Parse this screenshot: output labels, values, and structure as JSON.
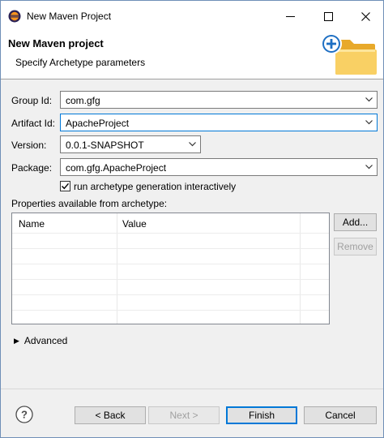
{
  "window": {
    "title": "New Maven Project"
  },
  "header": {
    "title": "New Maven project",
    "subtitle": "Specify Archetype parameters"
  },
  "form": {
    "group_id": {
      "label": "Group Id:",
      "value": "com.gfg"
    },
    "artifact_id": {
      "label": "Artifact Id:",
      "value": "ApacheProject"
    },
    "version": {
      "label": "Version:",
      "value": "0.0.1-SNAPSHOT"
    },
    "package": {
      "label": "Package:",
      "value": "com.gfg.ApacheProject"
    },
    "interactive": {
      "label": "run archetype generation interactively",
      "checked": true
    }
  },
  "properties": {
    "label": "Properties available from archetype:",
    "columns": [
      "Name",
      "Value"
    ],
    "rows": [],
    "add_label": "Add...",
    "remove_label": "Remove"
  },
  "advanced": {
    "label": "Advanced"
  },
  "footer": {
    "back": "< Back",
    "next": "Next >",
    "finish": "Finish",
    "cancel": "Cancel"
  },
  "colors": {
    "focus": "#0078d7",
    "default_button": "#0078d7",
    "folder": "#f5c24b",
    "plus": "#1e6fc3"
  },
  "icons": [
    "eclipse-icon",
    "minimize-icon",
    "maximize-icon",
    "close-icon",
    "wizard-folder-icon",
    "chevron-down-icon",
    "checkmark-icon",
    "expand-arrow-icon",
    "help-icon"
  ]
}
